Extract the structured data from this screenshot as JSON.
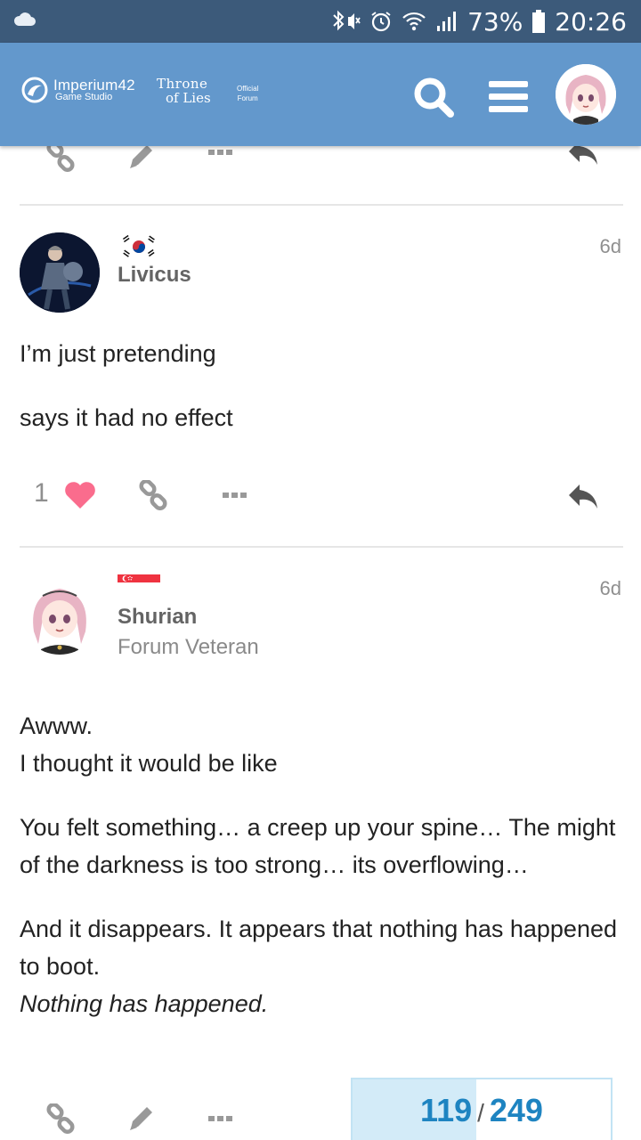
{
  "status_bar": {
    "battery": "73%",
    "time": "20:26",
    "icons": [
      "cloud-icon",
      "bluetooth-mute-icon",
      "alarm-icon",
      "wifi-icon",
      "signal-icon",
      "battery-icon"
    ]
  },
  "header": {
    "brand_name": "Imperium42",
    "brand_sub": "Game Studio",
    "game_line1": "Throne",
    "game_line2": "of Lies",
    "official_line1": "Official",
    "official_line2": "Forum",
    "icons": [
      "search-icon",
      "menu-icon",
      "user-avatar"
    ],
    "accent": "#6398cc"
  },
  "posts": [
    {
      "username": "Livicus",
      "title": "",
      "date": "6d",
      "flag": "south-korea-flag",
      "body": [
        "I’m just pretending",
        "says it had no effect"
      ],
      "likes": "1",
      "liked": true
    },
    {
      "username": "Shurian",
      "title": "Forum Veteran",
      "date": "6d",
      "flag": "singapore-flag",
      "body_p1_line1": "Awww.",
      "body_p1_line2": "I thought it would be like",
      "body_p2": "You felt something… a creep up your spine… The might of the darkness is too strong… its overflowing…",
      "body_p3_line1": "And it disappears. It appears that nothing has happened to boot.",
      "body_p3_line2": "Nothing has happened."
    }
  ],
  "progress": {
    "current": "119",
    "total": "249",
    "fraction": 0.478
  },
  "colors": {
    "heart": "#fa6c8d",
    "progress_text": "#1e84c1",
    "status_bar": "#3c5a7a"
  }
}
